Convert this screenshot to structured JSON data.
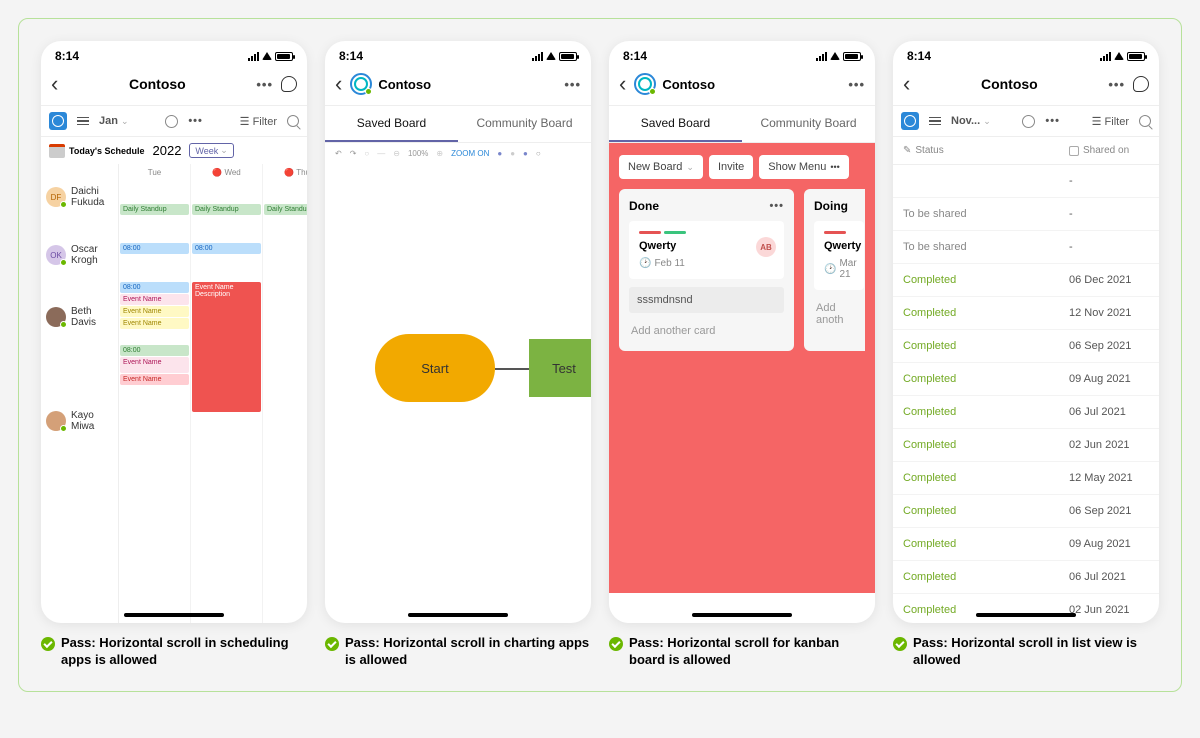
{
  "status_time": "8:14",
  "app_title": "Contoso",
  "filter_label": "Filter",
  "tabs": {
    "saved": "Saved Board",
    "community": "Community Board"
  },
  "phone1": {
    "month": "Jan",
    "today": "Today's Schedule",
    "year": "2022",
    "view": "Week",
    "days": [
      "Tue",
      "Wed",
      "Thur"
    ],
    "people": [
      "Daichi Fukuda",
      "Oscar Krogh",
      "Beth Davis",
      "Kayo Miwa"
    ],
    "ev_standup": "Daily Standup",
    "ev_name": "Event Name",
    "ev_desc": "Description"
  },
  "phone2": {
    "zoom_pct": "100%",
    "zoom_label": "ZOOM ON",
    "node_start": "Start",
    "node_test": "Test"
  },
  "phone3": {
    "btn_new": "New Board",
    "btn_invite": "Invite",
    "btn_menu": "Show Menu",
    "list_done": "Done",
    "list_doing": "Doing",
    "card_title": "Qwerty",
    "card_date1": "Feb 11",
    "card_date2": "Mar 21",
    "avatar": "AB",
    "input_text": "sssmdnsnd",
    "add_card": "Add another card",
    "add_card2": "Add anoth"
  },
  "phone4": {
    "month": "Nov...",
    "col_status": "Status",
    "col_shared": "Shared on",
    "rows": [
      {
        "status": "",
        "date": "-"
      },
      {
        "status": "To be shared",
        "date": "-"
      },
      {
        "status": "To be shared",
        "date": "-"
      },
      {
        "status": "Completed",
        "date": "06 Dec 2021"
      },
      {
        "status": "Completed",
        "date": "12 Nov 2021"
      },
      {
        "status": "Completed",
        "date": "06 Sep 2021"
      },
      {
        "status": "Completed",
        "date": "09 Aug 2021"
      },
      {
        "status": "Completed",
        "date": "06 Jul 2021"
      },
      {
        "status": "Completed",
        "date": "02 Jun 2021"
      },
      {
        "status": "Completed",
        "date": "12 May 2021"
      },
      {
        "status": "Completed",
        "date": "06 Sep 2021"
      },
      {
        "status": "Completed",
        "date": "09 Aug 2021"
      },
      {
        "status": "Completed",
        "date": "06 Jul 2021"
      },
      {
        "status": "Completed",
        "date": "02 Jun 2021"
      }
    ]
  },
  "captions": [
    "Pass: Horizontal scroll in scheduling apps is allowed",
    "Pass: Horizontal scroll in charting apps is allowed",
    "Pass: Horizontal scroll for kanban board is allowed",
    "Pass: Horizontal scroll in list view is allowed"
  ]
}
